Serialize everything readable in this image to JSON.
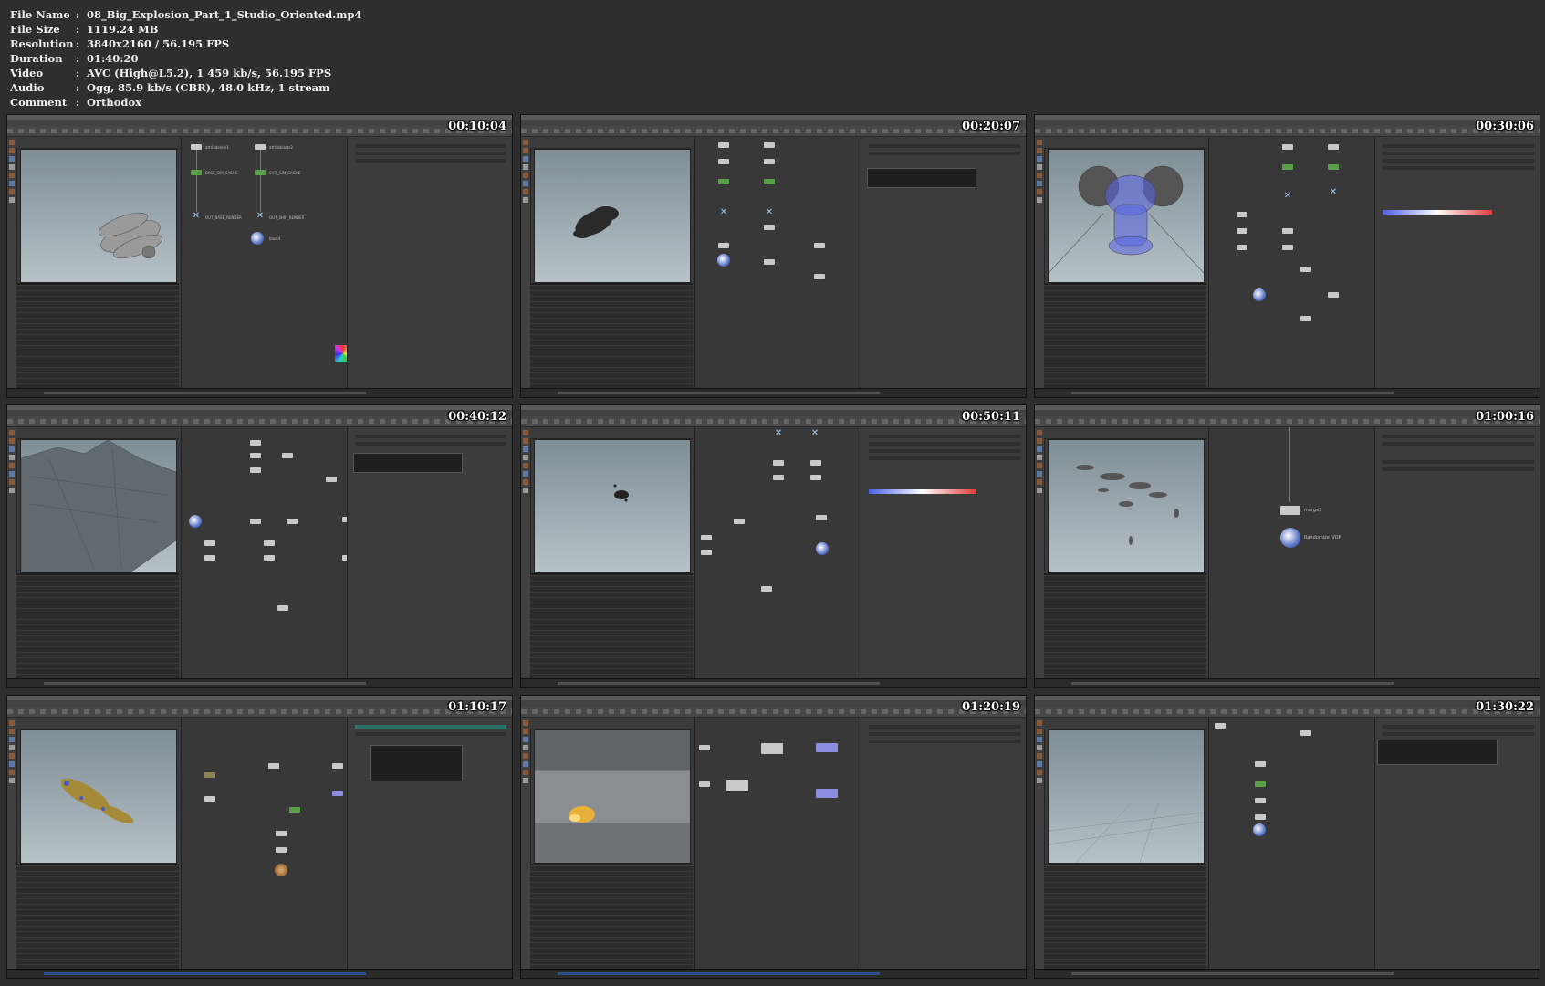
{
  "media_info": [
    {
      "key": "File Name",
      "value": "08_Big_Explosion_Part_1_Studio_Oriented.mp4"
    },
    {
      "key": "File Size",
      "value": "1119.24 MB"
    },
    {
      "key": "Resolution",
      "value": "3840x2160 / 56.195 FPS"
    },
    {
      "key": "Duration",
      "value": "01:40:20"
    },
    {
      "key": "Video",
      "value": "AVC (High@L5.2), 1 459 kb/s, 56.195 FPS"
    },
    {
      "key": "Audio",
      "value": "Ogg, 85.9 kb/s (CBR), 48.0 kHz, 1 stream"
    },
    {
      "key": "Comment",
      "value": "Orthodox"
    }
  ],
  "separator": ":",
  "thumbnails": [
    {
      "timestamp": "00:10:04",
      "nodes": [
        "attribdelete1",
        "attribdelete2",
        "BASE_SIM_CACHE",
        "SHIP_SIM_CACHE",
        "OUT_BASE_RENDER",
        "OUT_SHIP_RENDER",
        "blast4"
      ]
    },
    {
      "timestamp": "00:20:07"
    },
    {
      "timestamp": "00:30:06"
    },
    {
      "timestamp": "00:40:12"
    },
    {
      "timestamp": "00:50:11"
    },
    {
      "timestamp": "01:00:16",
      "nodes": [
        "merge3",
        "Randomize_VOP"
      ]
    },
    {
      "timestamp": "01:10:17"
    },
    {
      "timestamp": "01:20:19"
    },
    {
      "timestamp": "01:30:22"
    }
  ],
  "colors": {
    "background": "#2e2e2e",
    "viewport_top": "#7f8d95",
    "viewport_bottom": "#b7c2c8",
    "node_green": "#5aa04a",
    "node_purple": "#8c8ce0"
  }
}
